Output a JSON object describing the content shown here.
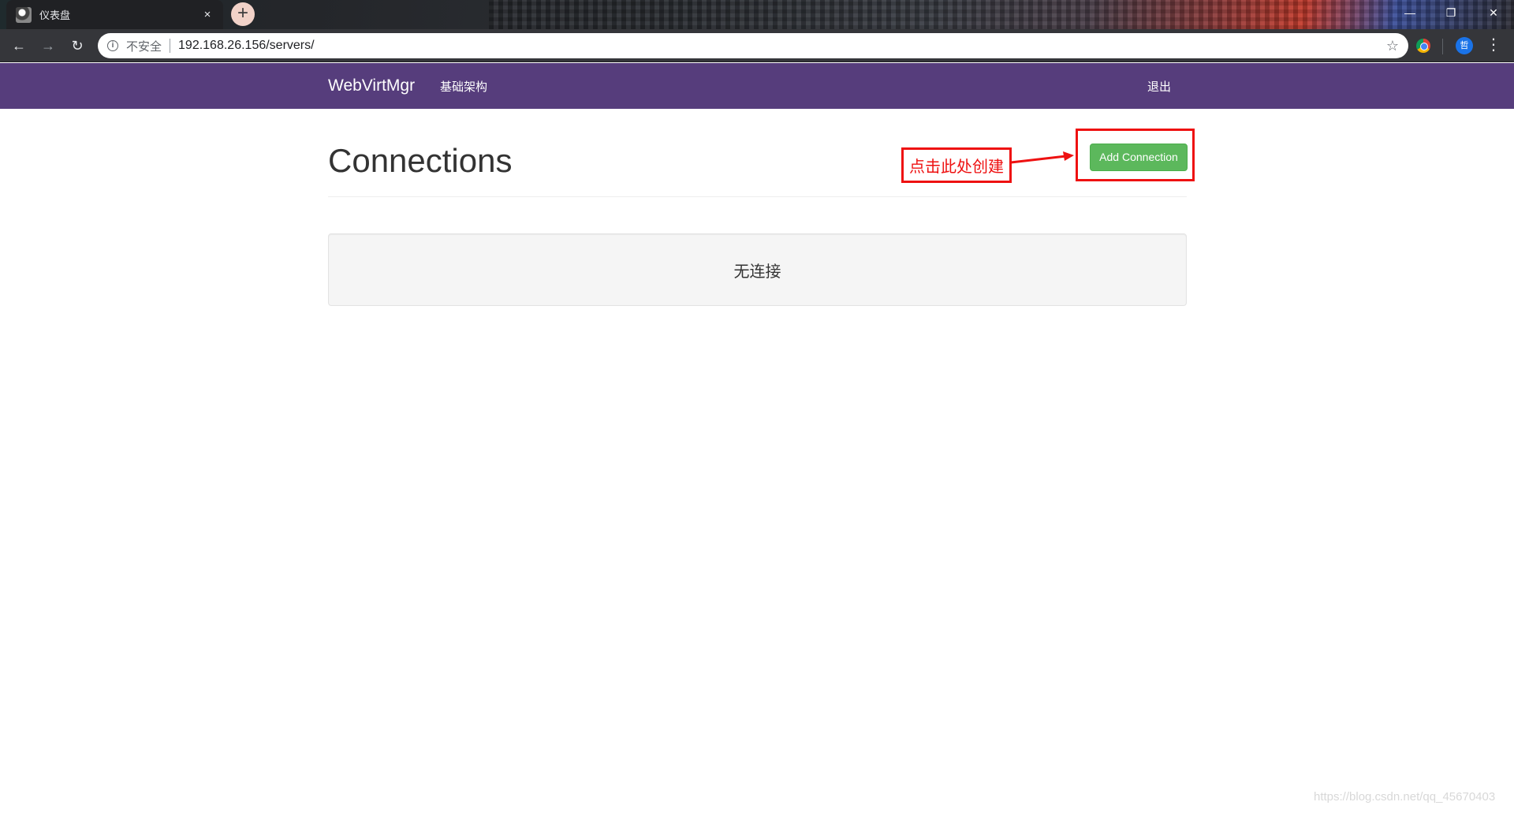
{
  "browser": {
    "tab": {
      "title": "仪表盘",
      "close_glyph": "×",
      "favicon": "webvirtmgr-favicon-icon"
    },
    "new_tab_glyph": "+",
    "window_controls": {
      "minimize": "—",
      "maximize": "❐",
      "close": "✕"
    },
    "nav": {
      "back": "←",
      "forward": "→",
      "reload": "↻"
    },
    "address_bar": {
      "security_label": "不安全",
      "info_glyph": "i",
      "url": "192.168.26.156/servers/",
      "star_glyph": "☆"
    },
    "profile_initial": "哲",
    "menu_glyph": "⋮"
  },
  "navbar": {
    "brand": "WebVirtMgr",
    "links": [
      {
        "label": "基础架构"
      }
    ],
    "logout": "退出",
    "color": "#563d7c"
  },
  "main": {
    "title": "Connections",
    "add_button": "Add Connection",
    "add_button_color": "#5cb85c",
    "empty_message": "无连接"
  },
  "annotation": {
    "label": "点击此处创建",
    "color": "#ee1111"
  },
  "watermark": "https://blog.csdn.net/qq_45670403"
}
